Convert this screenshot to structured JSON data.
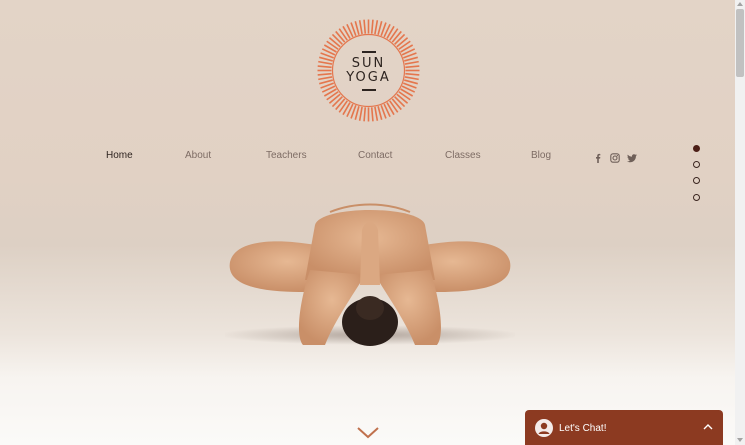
{
  "brand": {
    "line1": "SUN",
    "line2": "YOGA",
    "ring_color": "#e4764d"
  },
  "nav": {
    "items": [
      {
        "label": "Home",
        "active": true
      },
      {
        "label": "About",
        "active": false
      },
      {
        "label": "Teachers",
        "active": false
      },
      {
        "label": "Contact",
        "active": false
      },
      {
        "label": "Classes",
        "active": false
      },
      {
        "label": "Blog",
        "active": false
      }
    ]
  },
  "social": [
    "facebook-icon",
    "instagram-icon",
    "twitter-icon"
  ],
  "section_dots": {
    "count": 4,
    "active_index": 0
  },
  "hero": {
    "image": "yoga-pose-photo"
  },
  "scroll_down": "chevron-down-icon",
  "chat": {
    "label": "Let's Chat!",
    "color": "#8c3a21"
  }
}
